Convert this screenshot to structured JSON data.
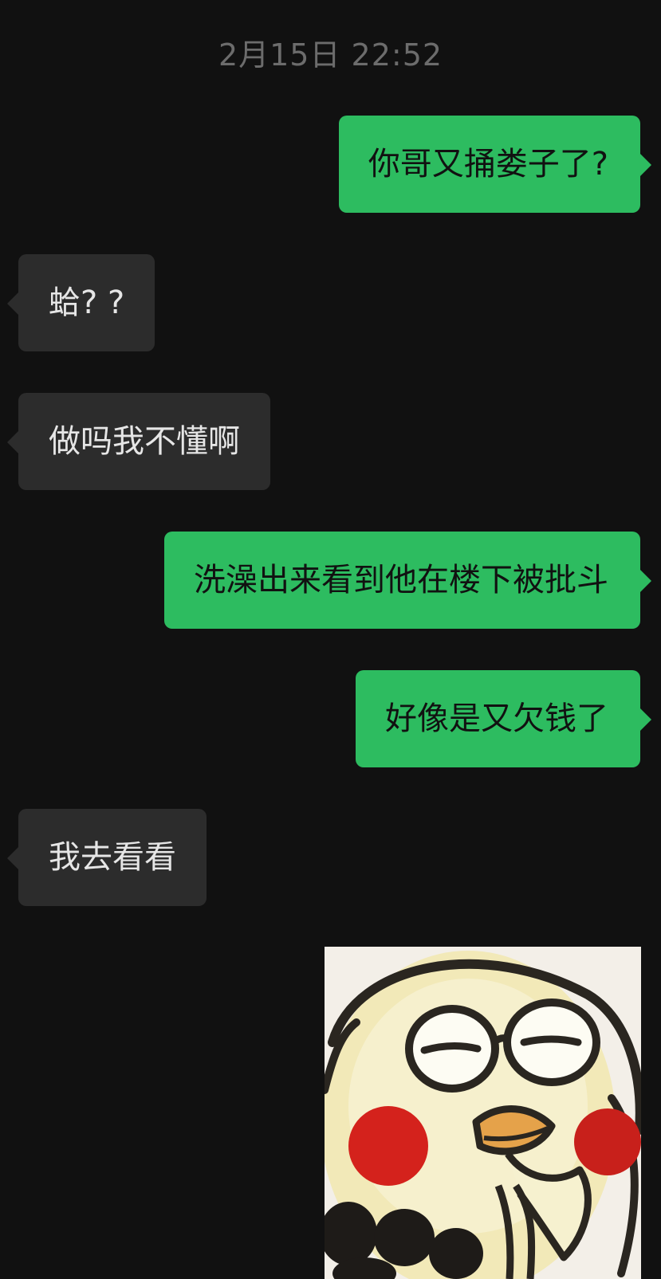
{
  "chat": {
    "timestamp": "2月15日 22:52",
    "messages": [
      {
        "side": "out",
        "text": "你哥又捅娄子了?"
      },
      {
        "side": "in",
        "text": "蛤? ?"
      },
      {
        "side": "in",
        "text": "做吗我不懂啊"
      },
      {
        "side": "out",
        "text": "洗澡出来看到他在楼下被批斗"
      },
      {
        "side": "out",
        "text": "好像是又欠钱了"
      },
      {
        "side": "in",
        "text": "我去看看"
      }
    ],
    "sticker": {
      "icon": "smirking-cartoon-sticker"
    }
  },
  "colors": {
    "background": "#111111",
    "outgoing_bubble": "#2dbc60",
    "incoming_bubble": "#2c2c2c",
    "timestamp_text": "#6c6c6c"
  }
}
